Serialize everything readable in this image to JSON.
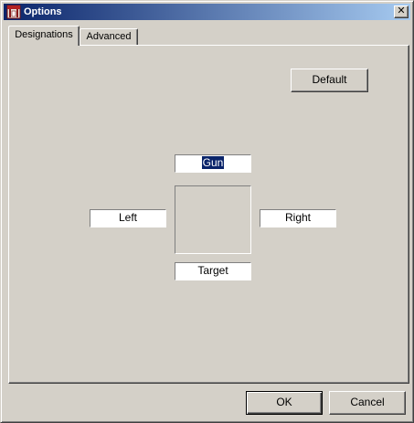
{
  "window": {
    "title": "Options",
    "close_glyph": "✕"
  },
  "tabs": [
    {
      "label": "Designations",
      "active": true
    },
    {
      "label": "Advanced",
      "active": false
    }
  ],
  "designations": {
    "default_label": "Default",
    "top_value": "Gun",
    "left_value": "Left",
    "right_value": "Right",
    "bottom_value": "Target"
  },
  "footer": {
    "ok_label": "OK",
    "cancel_label": "Cancel"
  },
  "icons": {
    "title": "options-window-icon",
    "close": "close-icon"
  },
  "colors": {
    "titlebar_start": "#0a246a",
    "titlebar_end": "#a6caf0",
    "face": "#d4d0c8",
    "selection": "#0a246a"
  }
}
